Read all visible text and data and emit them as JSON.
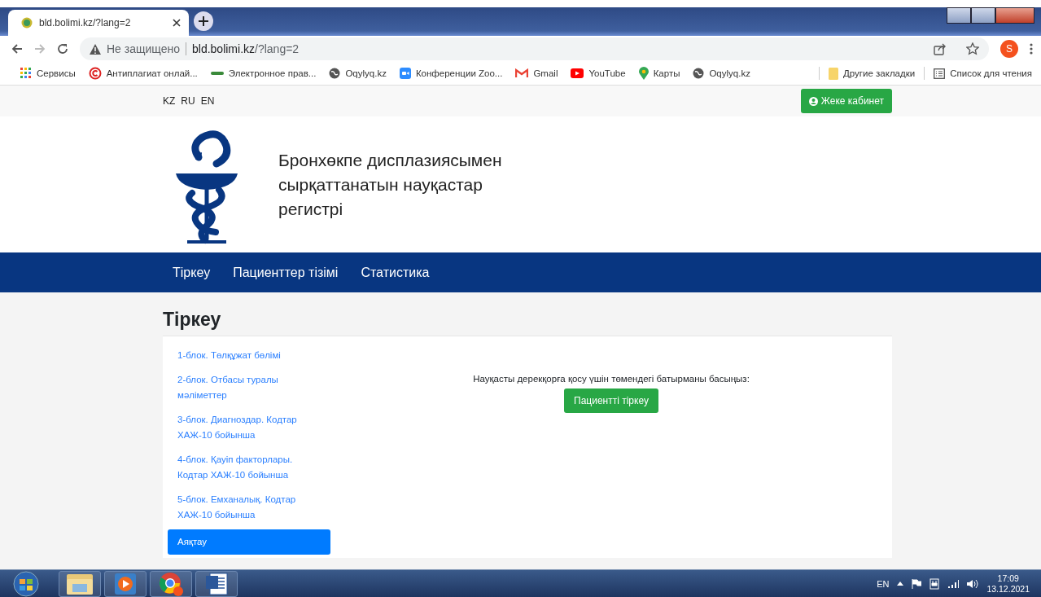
{
  "browser": {
    "tab": {
      "title": "bld.bolimi.kz/?lang=2"
    },
    "address": {
      "security": "Не защищено",
      "host": "bld.bolimi.kz",
      "path": "/?lang=2"
    },
    "profile_initial": "S",
    "bookmarks": [
      {
        "kind": "apps",
        "label": "Сервисы"
      },
      {
        "kind": "copyright",
        "label": "Антиплагиат онлай..."
      },
      {
        "kind": "egov",
        "label": "Электронное прав..."
      },
      {
        "kind": "globe",
        "label": "Oqylyq.kz"
      },
      {
        "kind": "video",
        "label": "Конференции Zoo..."
      },
      {
        "kind": "mail",
        "label": "Gmail"
      },
      {
        "kind": "play",
        "label": "YouTube"
      },
      {
        "kind": "pin",
        "label": "Карты"
      },
      {
        "kind": "globe",
        "label": "Oqylyq.kz"
      }
    ],
    "other_bookmarks": "Другие закладки",
    "reading_list": "Список для чтения"
  },
  "site": {
    "languages": [
      "KZ",
      "RU",
      "EN"
    ],
    "cabinet_button": "Жеке кабинет",
    "title": "Бронхөкпе дисплазиясымен сырқаттанатын науқастар регистрі",
    "nav": [
      "Тіркеу",
      "Пациенттер тізімі",
      "Статистика"
    ],
    "page_title": "Тіркеу",
    "steps": [
      {
        "label": "1-блок. Төлқұжат бөлімі",
        "selected": false
      },
      {
        "label": "2-блок. Отбасы туралы мәліметтер",
        "selected": false
      },
      {
        "label": "3-блок. Диагноздар. Кодтар ХАЖ-10 бойынша",
        "selected": false
      },
      {
        "label": "4-блок. Қауіп факторлары. Кодтар ХАЖ-10 бойынша",
        "selected": false
      },
      {
        "label": "5-блок. Емханалық. Кодтар ХАЖ-10 бойынша",
        "selected": false
      },
      {
        "label": "Аяқтау",
        "selected": true
      }
    ],
    "prompt": "Науқасты дерекқорға қосу үшін төмендегі батырманы басыңыз:",
    "register_button": "Пациентті тіркеу"
  },
  "taskbar": {
    "apps": [
      {
        "kind": "folder"
      },
      {
        "kind": "media"
      },
      {
        "kind": "browser"
      },
      {
        "kind": "word"
      }
    ],
    "language": "EN",
    "time": "17:09",
    "date": "13.12.2021"
  }
}
